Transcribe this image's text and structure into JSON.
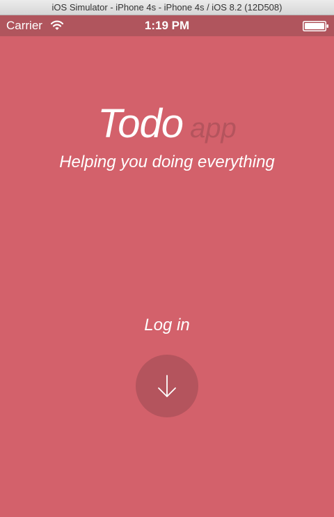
{
  "window": {
    "title": "iOS Simulator - iPhone 4s - iPhone 4s / iOS 8.2 (12D508)"
  },
  "statusbar": {
    "carrier": "Carrier",
    "time": "1:19 PM",
    "wifi_icon": "wifi-icon",
    "battery_icon": "battery-icon",
    "battery_level": 1.0
  },
  "app": {
    "logo_main": "Todo",
    "logo_sub": "app",
    "tagline": "Helping you doing everything",
    "login_label": "Log in",
    "login_button_icon": "arrow-down-icon"
  },
  "colors": {
    "background": "#d3616b",
    "statusbar": "#b0555d",
    "accent_dark": "#b4545d",
    "text": "#ffffff"
  }
}
